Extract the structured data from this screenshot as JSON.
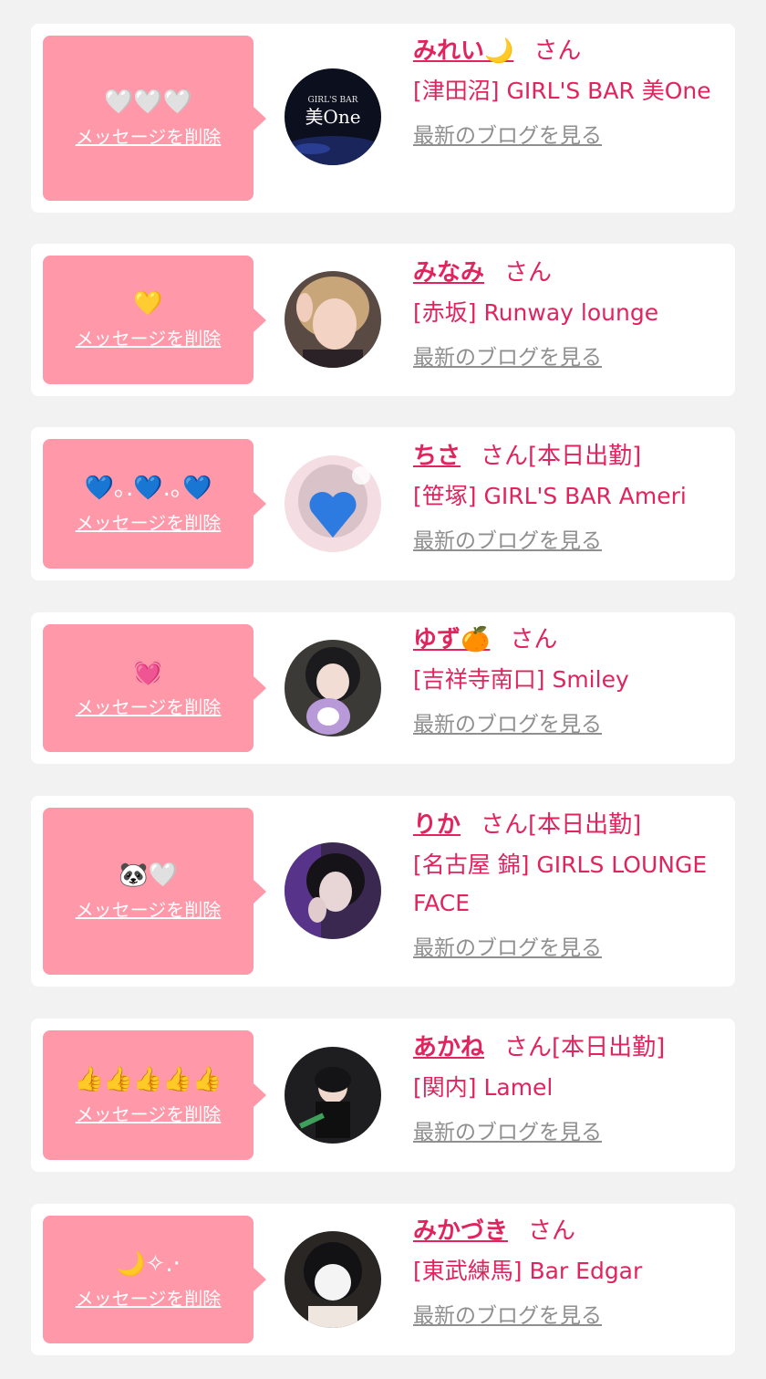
{
  "delete_label": "メッセージを削除",
  "blog_label": "最新のブログを見る",
  "san_label": "さん",
  "items": [
    {
      "name": "みれい🌙",
      "status": "",
      "shop": "[津田沼] GIRL'S BAR 美One",
      "message": "🤍🤍🤍",
      "avatar_logo_small": "GIRL'S BAR",
      "avatar_logo_big": "美One"
    },
    {
      "name": "みなみ",
      "status": "",
      "shop": "[赤坂] Runway lounge",
      "message": "💛"
    },
    {
      "name": "ちさ",
      "status": "[本日出勤]",
      "shop": "[笹塚] GIRL'S BAR Ameri",
      "message": "💙｡.💙.｡💙"
    },
    {
      "name": "ゆず🍊",
      "status": "",
      "shop": "[吉祥寺南口] Smiley",
      "message": "💓"
    },
    {
      "name": "りか",
      "status": "[本日出勤]",
      "shop": "[名古屋 錦] GIRLS LOUNGE FACE",
      "message": "🐼🤍"
    },
    {
      "name": "あかね",
      "status": "[本日出勤]",
      "shop": "[関内] Lamel",
      "message": "👍👍👍👍👍"
    },
    {
      "name": "みかづき",
      "status": "",
      "shop": "[東武練馬] Bar Edgar",
      "message": "🌙✧.·"
    }
  ],
  "colors": {
    "bubble": "#ff98a8",
    "accent": "#e0245e",
    "link_gray": "#8f8f8f",
    "background": "#f2f2f2"
  }
}
